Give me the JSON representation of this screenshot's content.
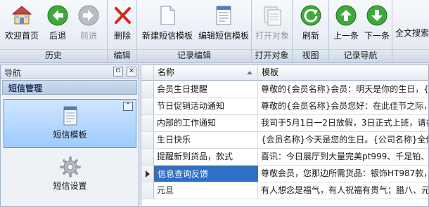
{
  "ribbon": {
    "groups": [
      {
        "label": "历史",
        "buttons": [
          {
            "label": "欢迎首页",
            "icon": "home-icon"
          },
          {
            "label": "后退",
            "icon": "back-icon"
          },
          {
            "label": "前进",
            "icon": "forward-icon",
            "disabled": true
          }
        ]
      },
      {
        "label": "编辑",
        "buttons": [
          {
            "label": "删除",
            "icon": "delete-icon"
          }
        ]
      },
      {
        "label": "记录编辑",
        "buttons": [
          {
            "label": "新建短信模板",
            "icon": "new-document-icon"
          },
          {
            "label": "编辑短信模板",
            "icon": "edit-document-icon"
          }
        ]
      },
      {
        "label": "打开对象",
        "buttons": [
          {
            "label": "打开对象",
            "icon": "open-object-icon",
            "disabled": true
          }
        ]
      },
      {
        "label": "视图",
        "buttons": [
          {
            "label": "刷新",
            "icon": "refresh-icon"
          }
        ]
      },
      {
        "label": "记录导航",
        "buttons": [
          {
            "label": "上一条",
            "icon": "up-arrow-icon"
          },
          {
            "label": "下一条",
            "icon": "down-arrow-icon"
          }
        ]
      },
      {
        "label": "",
        "buttons": [
          {
            "label": "全文搜索",
            "icon": "search-icon"
          }
        ]
      }
    ]
  },
  "nav": {
    "title": "导航",
    "pin_glyph": "ㅁ",
    "close_glyph": "✕",
    "group_title": "短信管理",
    "collapse_glyph": "⌃",
    "items": [
      {
        "label": "短信模板",
        "icon": "sms-template-icon",
        "selected": true
      },
      {
        "label": "短信设置",
        "icon": "gear-icon",
        "selected": false
      }
    ]
  },
  "grid": {
    "columns": [
      "名称",
      "模板"
    ],
    "rows": [
      {
        "name": "会员生日提醒",
        "template": "尊敬的{会员名称}会员：明天是你的生日，{公"
      },
      {
        "name": "节日促销活动通知",
        "template": "尊敬的{会员名称}会员您好：在此佳节之际，"
      },
      {
        "name": "内部的工作通知",
        "template": "我司于5月1日一2日放假，3日正式上班，请各"
      },
      {
        "name": "生日快乐",
        "template": "{会员名称}今天是您的生日。{公司名称}全体"
      },
      {
        "name": "提醒新到货品，款式",
        "template": "喜讯：今日展厅到大量完美pt999、千足铂、足"
      },
      {
        "name": "信息查询反馈",
        "template": "尊敬会员，您那边所需货品：银饰HT987款，"
      },
      {
        "name": "元旦",
        "template": "有人想念是福气，有人祝福有贵气；腊八、元"
      }
    ],
    "selected_row": 5
  },
  "colors": {
    "accent": "#2f6fc5",
    "ribbon_bg": "#e9eef5",
    "nav_selected": "#9ecbff"
  }
}
